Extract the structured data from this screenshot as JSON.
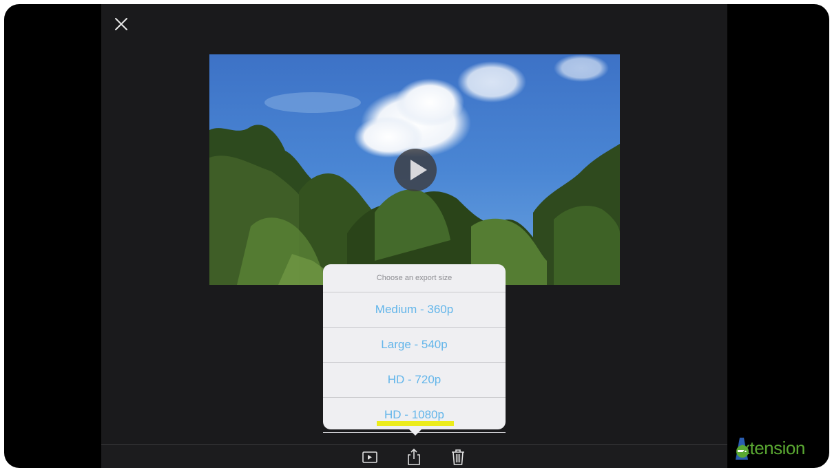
{
  "close_icon": "close-icon",
  "video": {
    "play_icon": "play-icon"
  },
  "export_popover": {
    "title": "Choose an export size",
    "options": [
      {
        "label": "Medium - 360p"
      },
      {
        "label": "Large - 540p"
      },
      {
        "label": "HD - 720p"
      },
      {
        "label": "HD - 1080p",
        "highlighted": true
      }
    ],
    "accent_color": "#62b5ea",
    "highlight_color": "#ecec1c"
  },
  "toolbar": {
    "icons": [
      "play-video-icon",
      "share-icon",
      "trash-icon"
    ]
  },
  "watermark": {
    "text": "xtension",
    "brand_color": "#5aa832"
  }
}
